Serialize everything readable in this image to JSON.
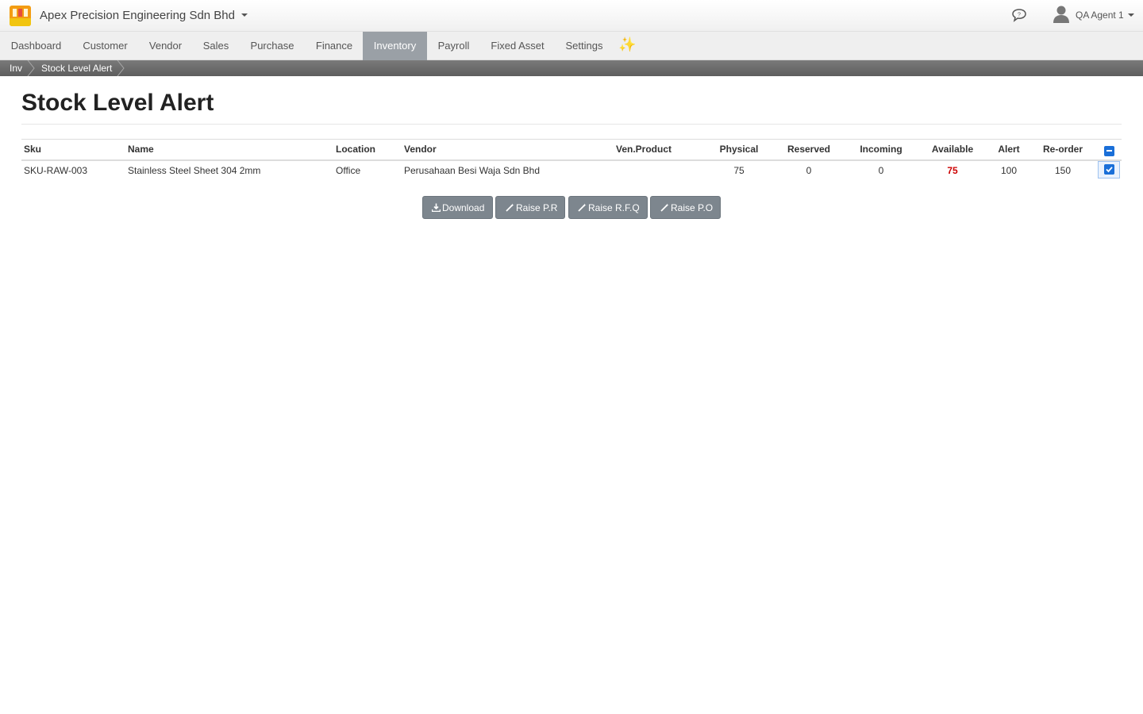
{
  "app": {
    "company": "Apex Precision Engineering Sdn Bhd",
    "user": "QA Agent 1"
  },
  "menu": {
    "items": [
      {
        "label": "Dashboard",
        "active": false
      },
      {
        "label": "Customer",
        "active": false
      },
      {
        "label": "Vendor",
        "active": false
      },
      {
        "label": "Sales",
        "active": false
      },
      {
        "label": "Purchase",
        "active": false
      },
      {
        "label": "Finance",
        "active": false
      },
      {
        "label": "Inventory",
        "active": true
      },
      {
        "label": "Payroll",
        "active": false
      },
      {
        "label": "Fixed Asset",
        "active": false
      },
      {
        "label": "Settings",
        "active": false
      }
    ],
    "sparkle": "✨"
  },
  "breadcrumb": [
    "Inv",
    "Stock Level Alert"
  ],
  "page": {
    "title": "Stock Level Alert"
  },
  "table": {
    "headers": [
      "Sku",
      "Name",
      "Location",
      "Vendor",
      "Ven.Product",
      "Physical",
      "Reserved",
      "Incoming",
      "Available",
      "Alert",
      "Re-order"
    ],
    "rows": [
      {
        "sku": "SKU-RAW-003",
        "name": "Stainless Steel Sheet 304 2mm",
        "location": "Office",
        "vendor": "Perusahaan Besi Waja Sdn Bhd",
        "ven_product": "",
        "physical": "75",
        "reserved": "0",
        "incoming": "0",
        "available": "75",
        "alert": "100",
        "reorder": "150",
        "checked": true
      }
    ],
    "header_checkbox_state": "indeterminate"
  },
  "actions": {
    "download": "Download",
    "raise_pr": "Raise P.R",
    "raise_rfq": "Raise R.F.Q",
    "raise_po": "Raise P.O"
  },
  "colors": {
    "active_tab": "#9aa0a6",
    "danger_value": "#cc0000",
    "button": "#7d868e",
    "checkbox": "#1a6fd8"
  }
}
